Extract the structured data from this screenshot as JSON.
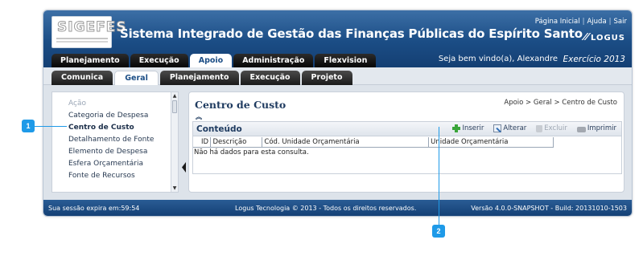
{
  "header": {
    "logo_text": "SIGEFES",
    "title": "Sistema Integrado de Gestão das Finanças Públicas do Espírito Santo",
    "top_links": [
      "Página Inicial",
      "Ajuda",
      "Sair"
    ],
    "brand": "LOGUS",
    "welcome": "Seja bem vindo(a), Alexandre",
    "year": "Exercício 2013"
  },
  "main_tabs": [
    {
      "label": "Planejamento"
    },
    {
      "label": "Execução"
    },
    {
      "label": "Apoio",
      "active": true
    },
    {
      "label": "Administração"
    },
    {
      "label": "Flexvision"
    }
  ],
  "sub_tabs": [
    {
      "label": "Comunica"
    },
    {
      "label": "Geral",
      "active": true
    },
    {
      "label": "Planejamento"
    },
    {
      "label": "Execução"
    },
    {
      "label": "Projeto"
    }
  ],
  "sidebar": {
    "items": [
      {
        "label": "Ação"
      },
      {
        "label": "Categoria de Despesa"
      },
      {
        "label": "Centro de Custo",
        "selected": true
      },
      {
        "label": "Detalhamento de Fonte"
      },
      {
        "label": "Elemento de Despesa"
      },
      {
        "label": "Esfera Orçamentária"
      },
      {
        "label": "Fonte de Recursos"
      }
    ]
  },
  "content": {
    "title": "Centro de Custo",
    "breadcrumb": "Apoio > Geral > Centro de Custo",
    "panel_title": "Conteúdo",
    "toolbar": {
      "insert": "Inserir",
      "edit": "Alterar",
      "delete": "Excluir",
      "print": "Imprimir"
    },
    "table": {
      "columns": [
        "ID",
        "Descrição",
        "Cód. Unidade Orçamentária",
        "Unidade Orçamentária"
      ],
      "empty_message": "Não há dados para esta consulta."
    }
  },
  "footer": {
    "session": "Sua sessão expira em:59:54",
    "copyright": "Logus Tecnologia © 2013 - Todos os direitos reservados.",
    "version": "Versão 4.0.0-SNAPSHOT - Build: 20131010-1503"
  },
  "callouts": [
    "1",
    "2"
  ],
  "colors": {
    "header_blue": "#1b4d85",
    "callout_blue": "#1e9ae8",
    "title_blue": "#1f3b60"
  }
}
